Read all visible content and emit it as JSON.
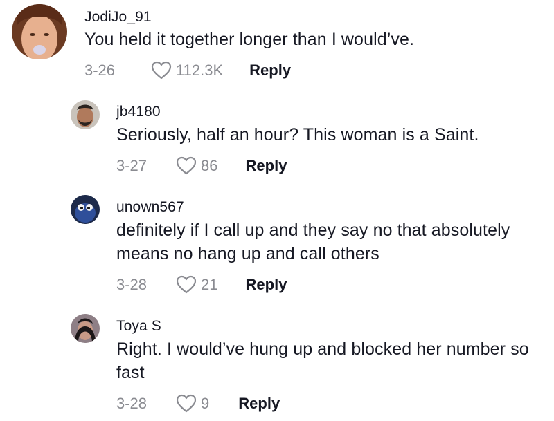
{
  "comments": [
    {
      "username": "JodiJo_91",
      "text": "You held it together longer than I would’ve.",
      "date": "3-26",
      "likes": "112.3K",
      "reply_label": "Reply"
    },
    {
      "username": "jb4180",
      "text": "Seriously, half an hour? This woman is a Saint.",
      "date": "3-27",
      "likes": "86",
      "reply_label": "Reply"
    },
    {
      "username": "unown567",
      "text": "definitely if I call up and they say no that absolutely means no hang up and call others",
      "date": "3-28",
      "likes": "21",
      "reply_label": "Reply"
    },
    {
      "username": "Toya S",
      "text": "Right. I would’ve hung up and blocked her number so fast",
      "date": "3-28",
      "likes": "9",
      "reply_label": "Reply"
    }
  ],
  "colors": {
    "text": "#161823",
    "muted": "#8a8b91",
    "background": "#ffffff"
  },
  "icons": {
    "like": "heart-outline-icon"
  }
}
